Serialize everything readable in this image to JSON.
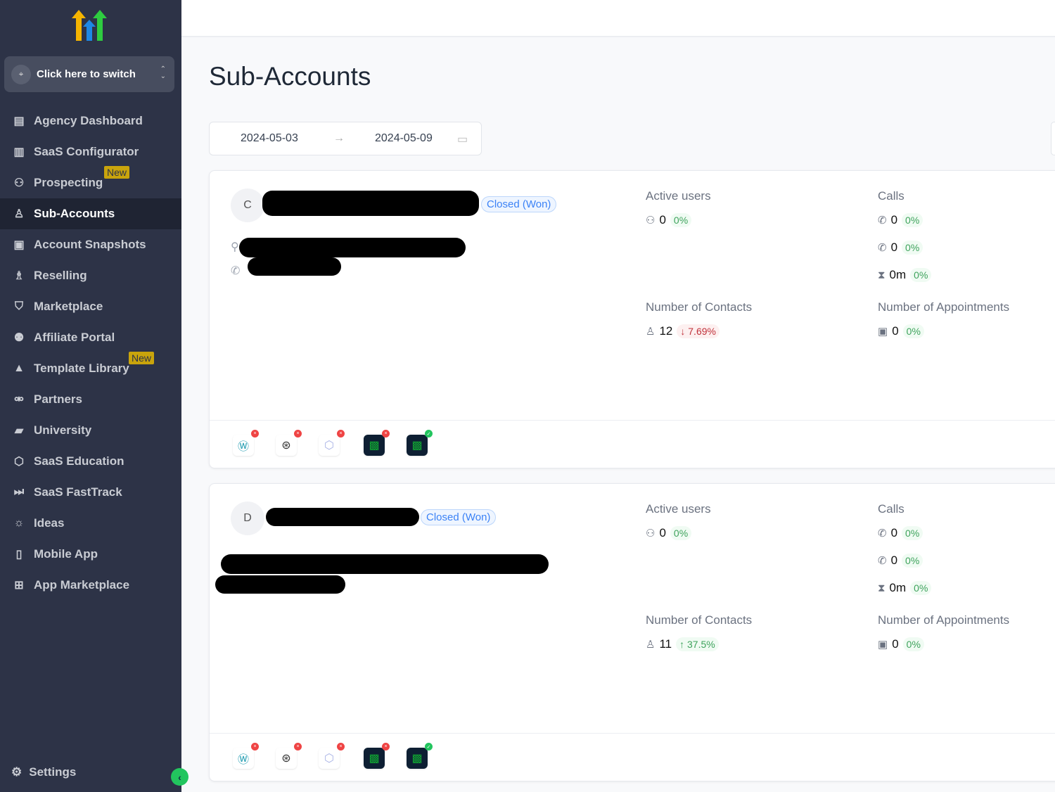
{
  "sidebar": {
    "switcher": "Click here to switch",
    "items": [
      {
        "label": "Agency Dashboard",
        "icon": "dashboard-icon"
      },
      {
        "label": "SaaS Configurator",
        "icon": "chart-bars-icon"
      },
      {
        "label": "Prospecting",
        "icon": "user-search-icon",
        "badge": "New"
      },
      {
        "label": "Sub-Accounts",
        "icon": "user-icon",
        "active": true
      },
      {
        "label": "Account Snapshots",
        "icon": "snapshot-icon"
      },
      {
        "label": "Reselling",
        "icon": "reselling-icon"
      },
      {
        "label": "Marketplace",
        "icon": "bag-icon"
      },
      {
        "label": "Affiliate Portal",
        "icon": "users-icon"
      },
      {
        "label": "Template Library",
        "icon": "shapes-icon",
        "badge": "New"
      },
      {
        "label": "Partners",
        "icon": "handshake-icon"
      },
      {
        "label": "University",
        "icon": "graduation-icon"
      },
      {
        "label": "SaaS Education",
        "icon": "cube-icon"
      },
      {
        "label": "SaaS FastTrack",
        "icon": "fast-forward-icon"
      },
      {
        "label": "Ideas",
        "icon": "lightbulb-icon"
      },
      {
        "label": "Mobile App",
        "icon": "mobile-icon"
      },
      {
        "label": "App Marketplace",
        "icon": "grid-icon"
      }
    ],
    "settings": "Settings"
  },
  "page": {
    "title": "Sub-Accounts",
    "date_from": "2024-05-03",
    "date_to": "2024-05-09"
  },
  "labels": {
    "active_users": "Active users",
    "calls": "Calls",
    "contacts": "Number of Contacts",
    "appointments": "Number of Appointments"
  },
  "accounts": [
    {
      "initial": "C",
      "status": "Closed (Won)",
      "active_users": "0",
      "active_users_pct": "0%",
      "calls_in": "0",
      "calls_in_pct": "0%",
      "calls_out": "0",
      "calls_out_pct": "0%",
      "call_time": "0m",
      "call_time_pct": "0%",
      "contacts": "12",
      "contacts_pct": "7.69%",
      "contacts_trend": "down",
      "appointments": "0",
      "appointments_pct": "0%"
    },
    {
      "initial": "D",
      "status": "Closed (Won)",
      "active_users": "0",
      "active_users_pct": "0%",
      "calls_in": "0",
      "calls_in_pct": "0%",
      "calls_out": "0",
      "calls_out_pct": "0%",
      "call_time": "0m",
      "call_time_pct": "0%",
      "contacts": "11",
      "contacts_pct": "37.5%",
      "contacts_trend": "up",
      "appointments": "0",
      "appointments_pct": "0%"
    }
  ],
  "colors": {
    "sidebar": "#2d3347",
    "accent_green": "#22c55e",
    "status_blue": "#3b82f6",
    "badge_new": "#c9a40c"
  }
}
